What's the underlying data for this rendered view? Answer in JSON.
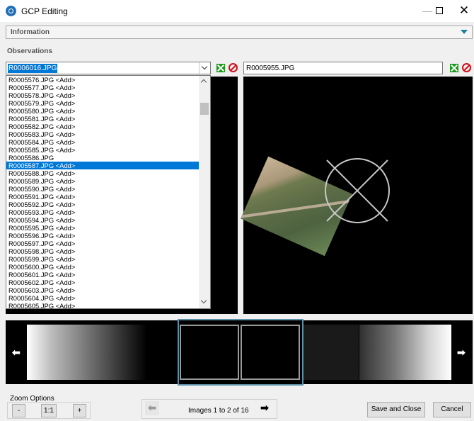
{
  "window": {
    "title": "GCP Editing"
  },
  "information": {
    "label": "Information"
  },
  "observations": {
    "label": "Observations",
    "left_selected": "R0006016.JPG",
    "right_value": "R0005955.JPG",
    "dropdown_items": [
      "R0005576.JPG <Add>",
      "R0005577.JPG <Add>",
      "R0005578.JPG <Add>",
      "R0005579.JPG <Add>",
      "R0005580.JPG <Add>",
      "R0005581.JPG <Add>",
      "R0005582.JPG <Add>",
      "R0005583.JPG <Add>",
      "R0005584.JPG <Add>",
      "R0005585.JPG <Add>",
      "R0005586.JPG",
      "R0005587.JPG <Add>",
      "R0005588.JPG <Add>",
      "R0005589.JPG <Add>",
      "R0005590.JPG <Add>",
      "R0005591.JPG <Add>",
      "R0005592.JPG <Add>",
      "R0005593.JPG <Add>",
      "R0005594.JPG <Add>",
      "R0005595.JPG <Add>",
      "R0005596.JPG <Add>",
      "R0005597.JPG <Add>",
      "R0005598.JPG <Add>",
      "R0005599.JPG <Add>",
      "R0005600.JPG <Add>",
      "R0005601.JPG <Add>",
      "R0005602.JPG <Add>",
      "R0005603.JPG <Add>",
      "R0005604.JPG <Add>",
      "R0005605.JPG <Add>"
    ],
    "highlighted_item": "R0005587.JPG <Add>"
  },
  "zoom": {
    "label": "Zoom Options",
    "minus": "-",
    "fit": "1:1",
    "plus": "+"
  },
  "navigation": {
    "status": "Images 1 to 2 of 16"
  },
  "buttons": {
    "save_close": "Save and Close",
    "cancel": "Cancel"
  },
  "colors": {
    "accent": "#0078d7",
    "accept": "#1a9a1a",
    "remove": "#d0101c",
    "selection_frame": "#5b8fa8"
  }
}
